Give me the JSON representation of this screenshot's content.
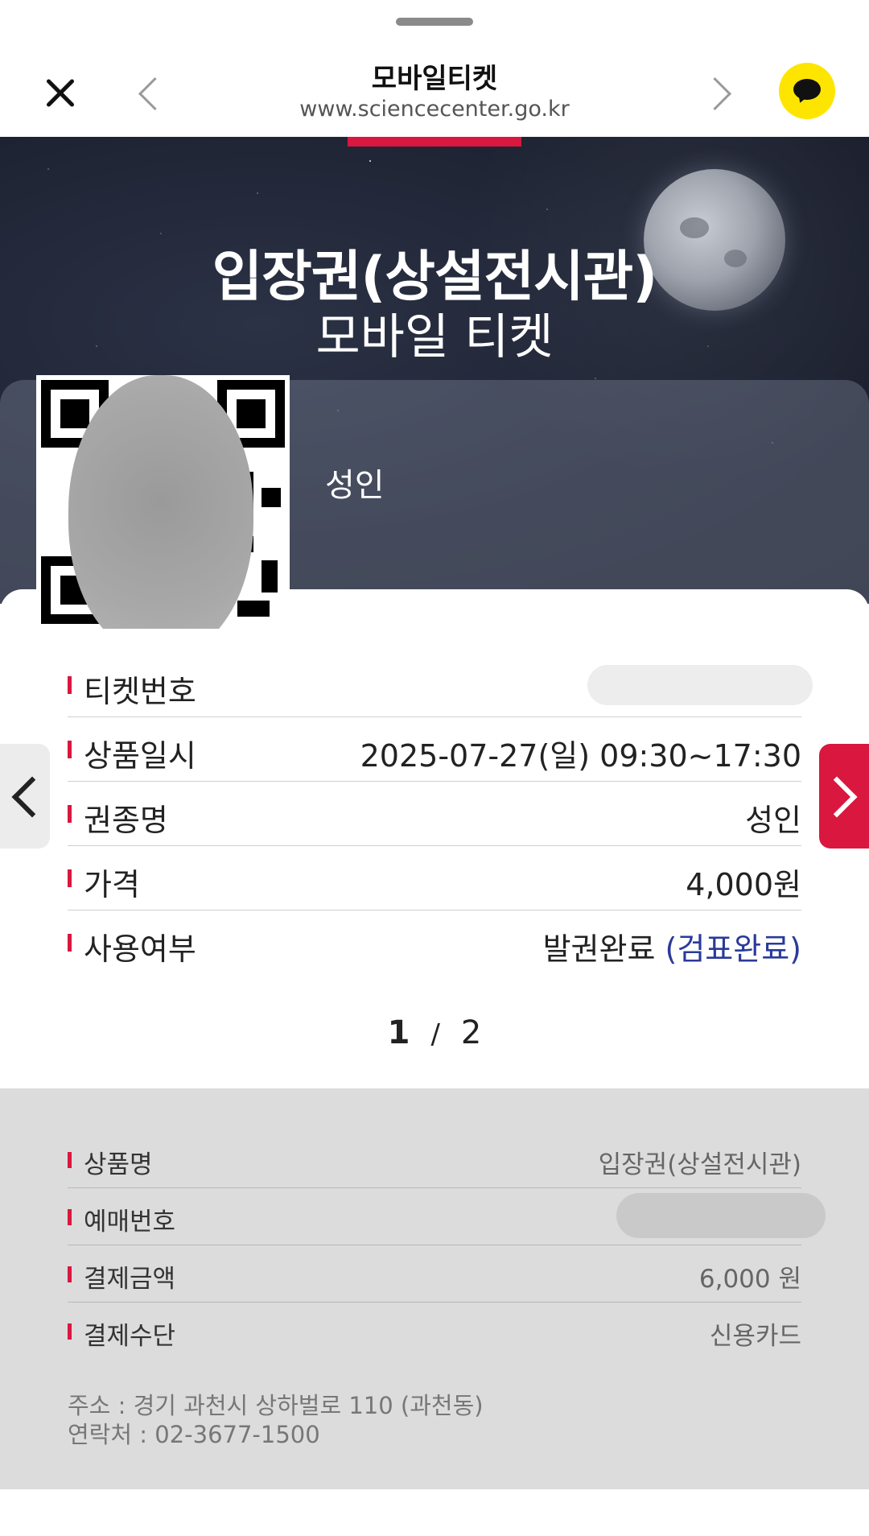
{
  "header": {
    "title": "모바일티켓",
    "url": "www.sciencecenter.go.kr"
  },
  "hero": {
    "title": "입장권(상설전시관)",
    "subtitle": "모바일 티켓",
    "ticket_type_label": "성인"
  },
  "ticket": {
    "rows": [
      {
        "label": "티켓번호",
        "value": ""
      },
      {
        "label": "상품일시",
        "value": "2025-07-27(일) 09:30~17:30"
      },
      {
        "label": "권종명",
        "value": "성인"
      },
      {
        "label": "가격",
        "value": "4,000원"
      },
      {
        "label": "사용여부",
        "value": "발권완료",
        "value_highlight": "(검표완료)"
      }
    ],
    "pager": {
      "current": "1",
      "separator": "/",
      "total": "2"
    }
  },
  "info": {
    "rows": [
      {
        "label": "상품명",
        "value": "입장권(상설전시관)"
      },
      {
        "label": "예매번호",
        "value": ""
      },
      {
        "label": "결제금액",
        "value": "6,000 원"
      },
      {
        "label": "결제수단",
        "value": "신용카드"
      }
    ],
    "address": "주소 : 경기 과천시 상하벌로 110 (과천동)",
    "contact": "연락처 : 02-3677-1500"
  },
  "colors": {
    "accent": "#d9173f",
    "kakao": "#FEE500",
    "highlight_text": "#2a3a9a"
  },
  "icons": {
    "close": "close-icon",
    "prev": "chevron-left-icon",
    "next": "chevron-right-icon",
    "chat": "kakao-chat-icon"
  }
}
